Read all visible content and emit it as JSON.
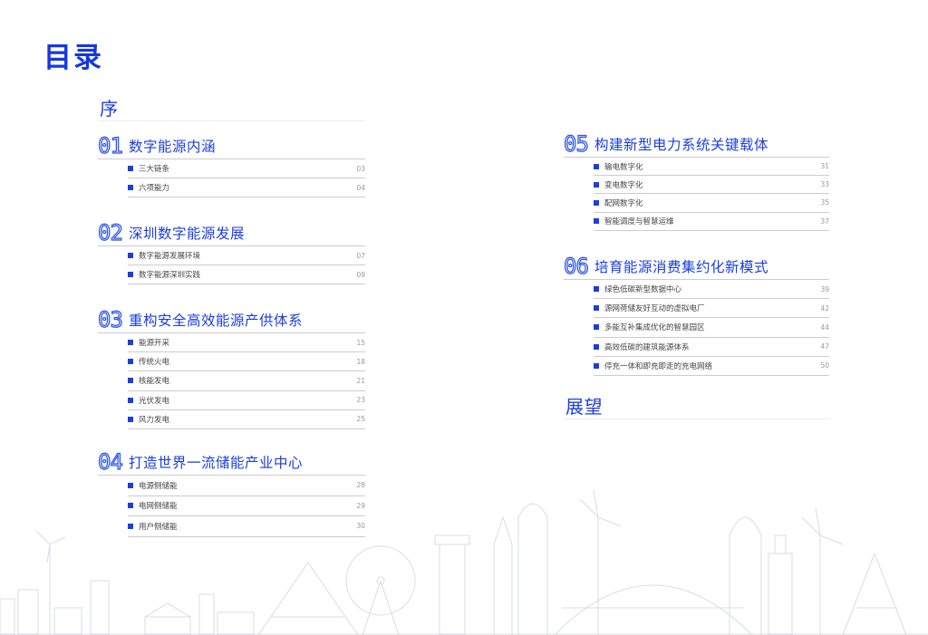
{
  "title": "目录",
  "sections": [
    {
      "id": "preface",
      "number": "",
      "title": "序",
      "items": []
    },
    {
      "id": "s01",
      "number": "01",
      "title": "数字能源内涵",
      "items": [
        {
          "label": "三大链条",
          "page": "03"
        },
        {
          "label": "六项能力",
          "page": "04"
        }
      ]
    },
    {
      "id": "s02",
      "number": "02",
      "title": "深圳数字能源发展",
      "items": [
        {
          "label": "数字能源发展环境",
          "page": "07"
        },
        {
          "label": "数字能源深圳实践",
          "page": "09"
        }
      ]
    },
    {
      "id": "s03",
      "number": "03",
      "title": "重构安全高效能源产供体系",
      "items": [
        {
          "label": "能源开采",
          "page": "15"
        },
        {
          "label": "传统火电",
          "page": "18"
        },
        {
          "label": "核能发电",
          "page": "21"
        },
        {
          "label": "光伏发电",
          "page": "23"
        },
        {
          "label": "风力发电",
          "page": "25"
        }
      ]
    },
    {
      "id": "s04",
      "number": "04",
      "title": "打造世界一流储能产业中心",
      "items": [
        {
          "label": "电源侧储能",
          "page": "28"
        },
        {
          "label": "电网侧储能",
          "page": "29"
        },
        {
          "label": "用户侧储能",
          "page": "30"
        }
      ]
    },
    {
      "id": "s05",
      "number": "05",
      "title": "构建新型电力系统关键载体",
      "items": [
        {
          "label": "输电数字化",
          "page": "31"
        },
        {
          "label": "变电数字化",
          "page": "33"
        },
        {
          "label": "配网数字化",
          "page": "35"
        },
        {
          "label": "智能调度与智慧运维",
          "page": "37"
        }
      ]
    },
    {
      "id": "s06",
      "number": "06",
      "title": "培育能源消费集约化新模式",
      "items": [
        {
          "label": "绿色低碳新型数据中心",
          "page": "39"
        },
        {
          "label": "源网荷储友好互动的虚拟电厂",
          "page": "42"
        },
        {
          "label": "多能互补集成优化的智慧园区",
          "page": "44"
        },
        {
          "label": "高效低碳的建筑能源体系",
          "page": "47"
        },
        {
          "label": "停充一体和即充即走的充电网络",
          "page": "50"
        }
      ]
    },
    {
      "id": "outlook",
      "number": "",
      "title": "展望",
      "items": []
    }
  ]
}
